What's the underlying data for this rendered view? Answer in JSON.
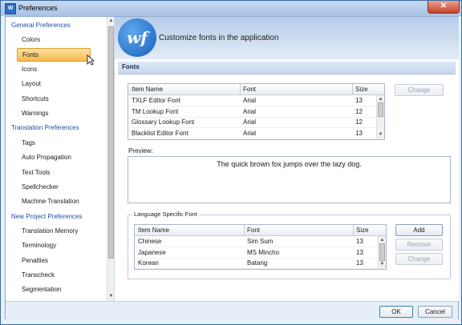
{
  "window": {
    "title": "Preferences",
    "close_glyph": "✕",
    "app_icon": "W"
  },
  "sidebar": {
    "items": [
      {
        "label": "General Preferences",
        "kind": "category"
      },
      {
        "label": "Colors",
        "kind": "item"
      },
      {
        "label": "Fonts",
        "kind": "item",
        "selected": true
      },
      {
        "label": "Icons",
        "kind": "item"
      },
      {
        "label": "Layout",
        "kind": "item"
      },
      {
        "label": "Shortcuts",
        "kind": "item"
      },
      {
        "label": "Warnings",
        "kind": "item"
      },
      {
        "label": "Translation Preferences",
        "kind": "category"
      },
      {
        "label": "Tags",
        "kind": "item"
      },
      {
        "label": "Auto Propagation",
        "kind": "item"
      },
      {
        "label": "Text Tools",
        "kind": "item"
      },
      {
        "label": "Spellchecker",
        "kind": "item"
      },
      {
        "label": "Machine Translation",
        "kind": "item"
      },
      {
        "label": "New Project Preferences",
        "kind": "category"
      },
      {
        "label": "Translation Memory",
        "kind": "item"
      },
      {
        "label": "Terminology",
        "kind": "item"
      },
      {
        "label": "Penalties",
        "kind": "item"
      },
      {
        "label": "Transcheck",
        "kind": "item"
      },
      {
        "label": "Segmentation",
        "kind": "item"
      }
    ]
  },
  "header": {
    "logo_text": "wf",
    "title": "Customize fonts in the application"
  },
  "section": {
    "title": "Fonts"
  },
  "fonts_table": {
    "columns": [
      "Item Name",
      "Font",
      "Size"
    ],
    "rows": [
      [
        "TXLF Editor Font",
        "Arial",
        "13"
      ],
      [
        "TM Lookup Font",
        "Arial",
        "12"
      ],
      [
        "Glossary Lookup Font",
        "Arial",
        "12"
      ],
      [
        "Blacklist Editor Font",
        "Arial",
        "13"
      ]
    ],
    "change_label": "Change"
  },
  "preview": {
    "label": "Preview:",
    "text": "The quick brown fox jumps over the lazy dog."
  },
  "language_fonts": {
    "label": "Language Specific Font",
    "columns": [
      "Item Name",
      "Font",
      "Size"
    ],
    "rows": [
      [
        "Chinese",
        "Sim Sum",
        "13"
      ],
      [
        "Japanese",
        "MS Mincho",
        "13"
      ],
      [
        "Korean",
        "Batang",
        "13"
      ]
    ],
    "add_label": "Add",
    "remove_label": "Remove",
    "change_label": "Change"
  },
  "footer": {
    "ok_label": "OK",
    "cancel_label": "Cancel"
  },
  "colors": {
    "accent": "#1f4fa6",
    "selection": "#f7b84b",
    "titlebar": "#a9c3e6"
  },
  "icons": {
    "up": "▲",
    "down": "▼"
  }
}
